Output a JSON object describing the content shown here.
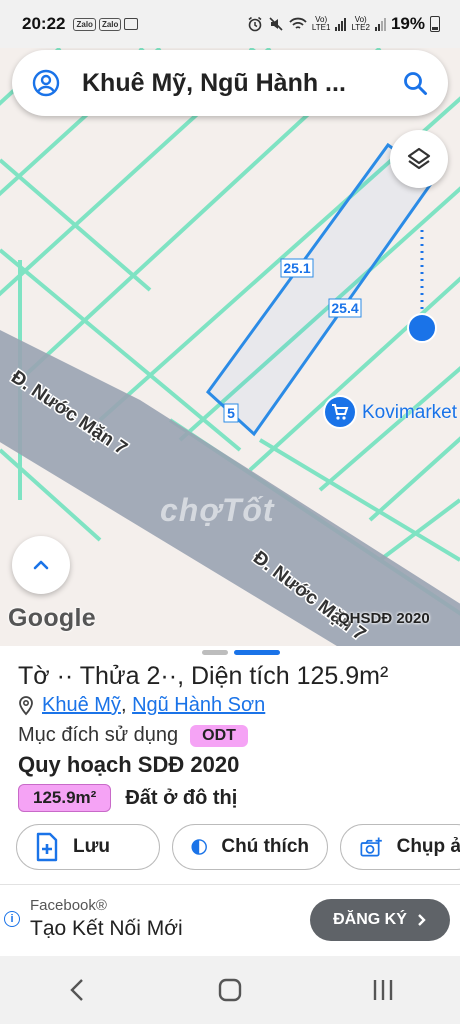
{
  "status_bar": {
    "time": "20:22",
    "zalo_label": "Zalo",
    "network_1": "Vo)\nLTE1",
    "network_2": "Vo)\nLTE2",
    "battery": "19%"
  },
  "search": {
    "title": "Khuê Mỹ, Ngũ Hành ..."
  },
  "map": {
    "parcel_edge_labels": [
      "25.1",
      "25.4",
      "5"
    ],
    "road_labels": [
      "Đ. Nước Mặn 7",
      "Đ. Nước Mặn 7"
    ],
    "poi_label": "Kovimarket",
    "watermark": "chợTốt",
    "google_logo": "Google",
    "layer_name": "QHSDĐ 2020",
    "colors": {
      "background": "#f4efec",
      "grid_lines": "#7fe3c3",
      "road": "#9aa3b3",
      "parcel_outline": "#2b8be6",
      "location_dot": "#1a73e8"
    }
  },
  "sheet": {
    "title": "Tờ ·· Thửa 2··, Diện tích 125.9m²",
    "address_commune": "Khuê Mỹ",
    "address_separator": ", ",
    "address_district": "Ngũ Hành Sơn",
    "purpose_label": "Mục đích sử dụng",
    "purpose_code": "ODT",
    "plan_title": "Quy hoạch SDĐ 2020",
    "area_value": "125.9m²",
    "land_type": "Đất ở đô thị",
    "actions": [
      "Lưu",
      "Chú thích",
      "Chụp ả"
    ]
  },
  "ad": {
    "source": "Facebook®",
    "title": "Tạo Kết Nối Mới",
    "cta": "ĐĂNG KÝ"
  }
}
